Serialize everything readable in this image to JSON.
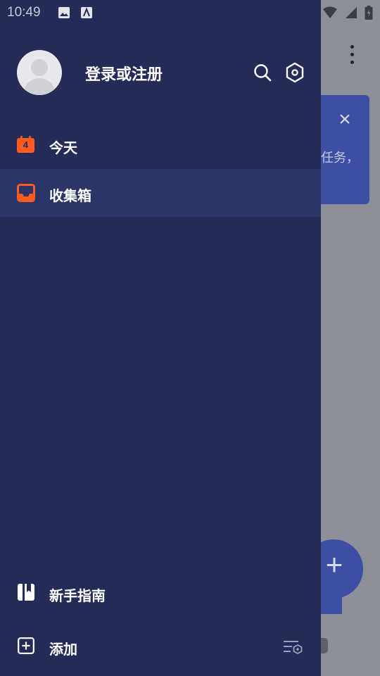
{
  "status_bar": {
    "time": "10:49"
  },
  "drawer": {
    "login_label": "登录或注册",
    "nav_items": [
      {
        "label": "今天",
        "badge": "4"
      },
      {
        "label": "收集箱"
      }
    ],
    "bottom_items": [
      {
        "label": "新手指南"
      },
      {
        "label": "添加"
      }
    ]
  },
  "background": {
    "card_text": "任务，"
  },
  "colors": {
    "drawer_bg": "#242b57",
    "active_row": "#2a3467",
    "accent_orange": "#ff5a1f",
    "brand_blue": "#3d4fa5"
  }
}
